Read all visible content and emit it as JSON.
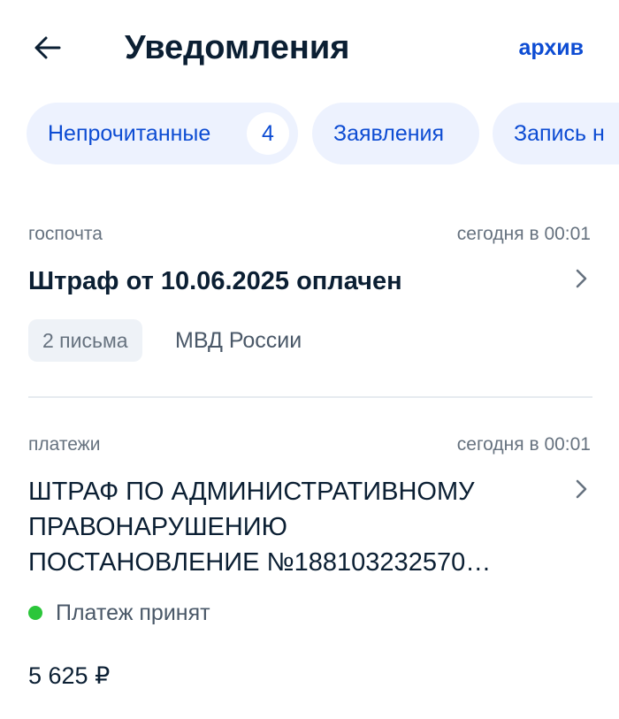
{
  "header": {
    "title": "Уведомления",
    "archive_label": "архив"
  },
  "chips": [
    {
      "label": "Непрочитанные",
      "count": "4"
    },
    {
      "label": "Заявления"
    },
    {
      "label": "Запись н"
    }
  ],
  "notifications": [
    {
      "category": "госпочта",
      "time": "сегодня в 00:01",
      "title": "Штраф от 10.06.2025 оплачен",
      "tag": "2 письма",
      "sender": "МВД России"
    },
    {
      "category": "платежи",
      "time": "сегодня в 00:01",
      "title_lines": [
        "ШТРАФ ПО АДМИНИСТРАТИВНОМУ",
        "ПРАВОНАРУШЕНИЮ",
        "ПОСТАНОВЛЕНИЕ №188103232570…"
      ],
      "status": "Платеж принят",
      "amount": "5 625 ₽"
    }
  ],
  "colors": {
    "accent": "#0d4cd3",
    "chip_bg": "#edf2fe",
    "status_ok": "#2bc63a",
    "text_primary": "#0b1f33",
    "text_secondary": "#66727f"
  },
  "icons": {
    "back": "arrow-left-icon",
    "chevron": "chevron-right-icon",
    "status": "status-dot-icon"
  }
}
